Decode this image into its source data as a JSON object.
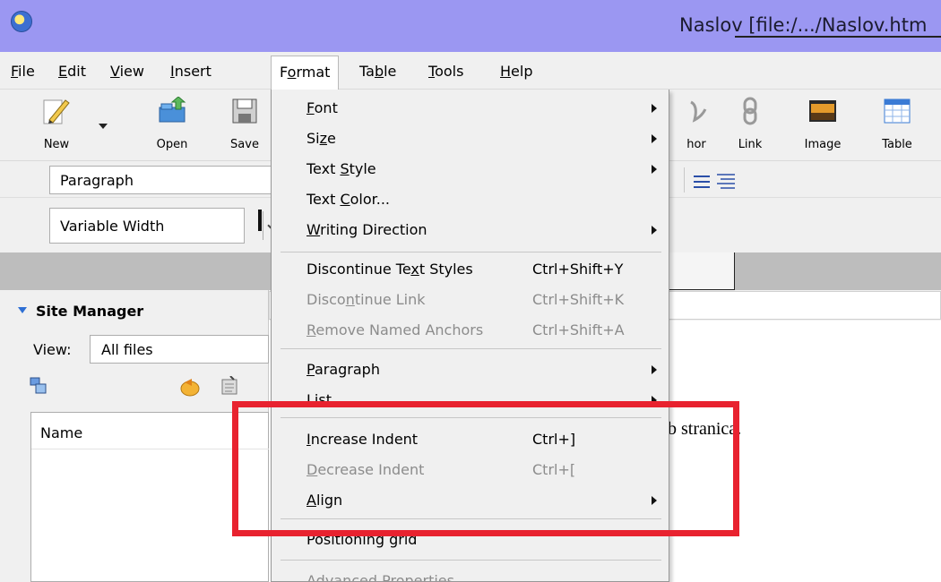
{
  "window": {
    "title": "Naslov [file:/.../Naslov.htm"
  },
  "menubar": {
    "items": [
      {
        "label": "File",
        "key": "F",
        "rest": "ile"
      },
      {
        "label": "Edit",
        "key": "E",
        "rest": "dit"
      },
      {
        "label": "View",
        "key": "V",
        "rest": "iew"
      },
      {
        "label": "Insert",
        "key": "I",
        "rest": "nsert"
      },
      {
        "label": "Format",
        "key": "o",
        "pre": "F",
        "rest": "rmat"
      },
      {
        "label": "Table",
        "key": "b",
        "pre": "Ta",
        "rest": "le"
      },
      {
        "label": "Tools",
        "key": "T",
        "rest": "ools"
      },
      {
        "label": "Help",
        "key": "H",
        "rest": "elp"
      }
    ]
  },
  "toolbar": {
    "new_label": "New",
    "open_label": "Open",
    "save_label": "Save",
    "anchor_label": "hor",
    "link_label": "Link",
    "image_label": "Image",
    "table_label": "Table"
  },
  "format_bar": {
    "paragraph_value": "Paragraph",
    "font_value": "Variable Width"
  },
  "site_manager": {
    "title": "Site Manager",
    "view_label": "View:",
    "view_value": "All files",
    "name_header": "Name"
  },
  "editor": {
    "text": "b stranica."
  },
  "format_menu": {
    "font": {
      "pre": "",
      "key": "F",
      "post": "ont"
    },
    "size": {
      "pre": "Si",
      "key": "z",
      "post": "e"
    },
    "text_style": {
      "pre": "Text ",
      "key": "S",
      "post": "tyle"
    },
    "text_color": {
      "pre": "Text ",
      "key": "C",
      "post": "olor..."
    },
    "writing_direction": {
      "pre": "",
      "key": "W",
      "post": "riting Direction"
    },
    "discontinue_text_styles": {
      "pre": "Discontinue Te",
      "key": "x",
      "post": "t Styles",
      "shortcut": "Ctrl+Shift+Y"
    },
    "discontinue_link": {
      "pre": "Disco",
      "key": "n",
      "post": "tinue Link",
      "shortcut": "Ctrl+Shift+K"
    },
    "remove_named_anchors": {
      "pre": "",
      "key": "R",
      "post": "emove Named Anchors",
      "shortcut": "Ctrl+Shift+A"
    },
    "paragraph": {
      "pre": "",
      "key": "P",
      "post": "aragraph"
    },
    "list": {
      "pre": "",
      "key": "L",
      "post": "ist"
    },
    "increase_indent": {
      "pre": "",
      "key": "I",
      "post": "ncrease Indent",
      "shortcut": "Ctrl+]"
    },
    "decrease_indent": {
      "pre": "",
      "key": "D",
      "post": "ecrease Indent",
      "shortcut": "Ctrl+["
    },
    "align": {
      "pre": "",
      "key": "A",
      "post": "lign"
    },
    "positioning_grid": {
      "pre": "Positioning grid",
      "key": "",
      "post": ""
    },
    "advanced_properties": {
      "pre": "Advanced Properties",
      "key": "",
      "post": ""
    }
  },
  "colors": {
    "title_bar": "#9b97f2",
    "highlight": "#e8222f",
    "disabled_text": "#8c8c8c"
  }
}
